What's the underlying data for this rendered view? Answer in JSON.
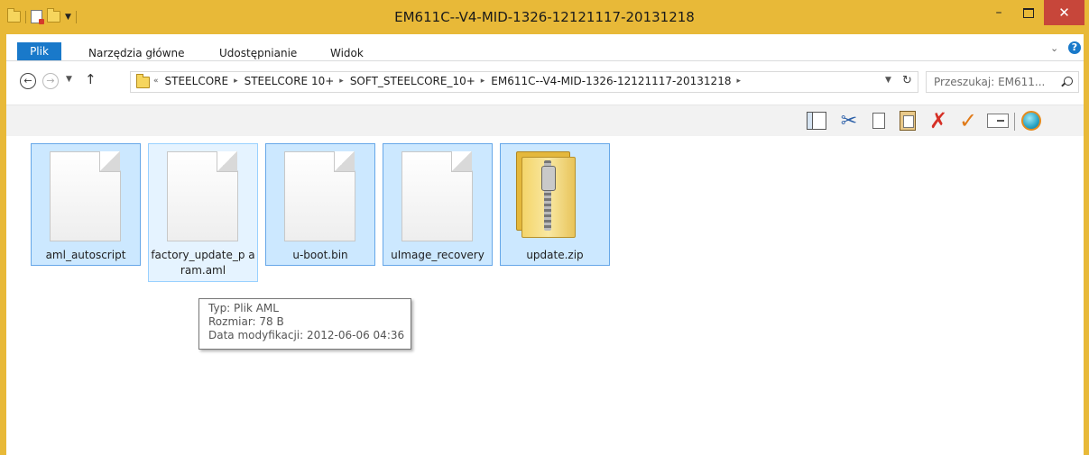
{
  "window": {
    "title": "EM611C--V4-MID-1326-12121117-20131218"
  },
  "ribbon": {
    "tabs": [
      "Plik",
      "Narzędzia główne",
      "Udostępnianie",
      "Widok"
    ],
    "help": "?"
  },
  "nav": {
    "path": [
      "STEELCORE",
      "STEELCORE 10+",
      "SOFT_STEELCORE_10+",
      "EM611C--V4-MID-1326-12121117-20131218"
    ],
    "search_placeholder": "Przeszukaj: EM611..."
  },
  "files": [
    {
      "name": "aml_autoscript",
      "icon": "document-icon"
    },
    {
      "name": "factory_update_param.aml",
      "icon": "document-icon",
      "display": "factory_update_p aram.aml"
    },
    {
      "name": "u-boot.bin",
      "icon": "document-icon"
    },
    {
      "name": "uImage_recovery",
      "icon": "document-icon"
    },
    {
      "name": "update.zip",
      "icon": "zip-folder-icon"
    }
  ],
  "tooltip": {
    "type": "Typ: Plik AML",
    "size": "Rozmiar: 78 B",
    "modified": "Data modyfikacji: 2012-06-06 04:36"
  },
  "colors": {
    "titlebar": "#e8b938",
    "selection": "#cce8ff",
    "selection_border": "#66a7e8",
    "file_tab": "#1979ca",
    "close_button": "#c7463a"
  }
}
